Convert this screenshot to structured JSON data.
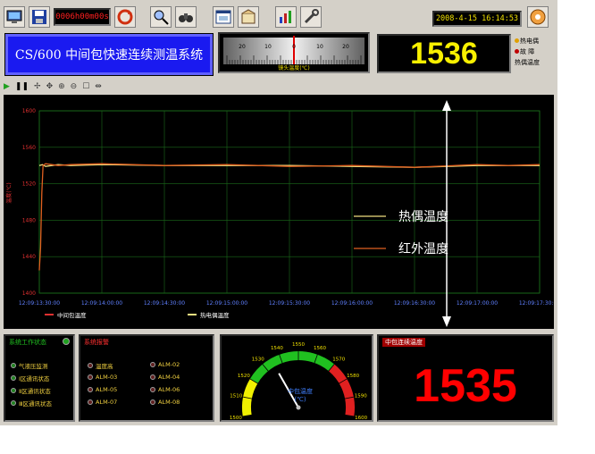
{
  "toolbar": {
    "timer_display": "0006h00m00s",
    "datetime": "2008-4-15 16:14:53",
    "icons": [
      "monitor-icon",
      "save-icon",
      "refresh-icon",
      "search-icon",
      "binoculars-icon",
      "window-icon",
      "cabinet-icon",
      "chart-icon",
      "tools-icon",
      "info-icon"
    ]
  },
  "header": {
    "system_title": "CS/600 中间包快速连续测温系统",
    "scale_label": "镜头温度(℃)",
    "scale_ticks": [
      "20",
      "10",
      "0",
      "10",
      "20"
    ],
    "current_temp": "1536",
    "legend": [
      {
        "label": "热电偶",
        "color": "#e0a000"
      },
      {
        "label": "故 障",
        "color": "#c00000"
      },
      {
        "label": "热偶温度",
        "color": ""
      }
    ]
  },
  "chart_tools": [
    "▶",
    "❚❚",
    "✢",
    "✥",
    "⊕",
    "⊖",
    "☐",
    "⇹"
  ],
  "chart_data": {
    "type": "line",
    "ylabel": "温度(℃)",
    "y_ticks": [
      "1600",
      "1560",
      "1520",
      "1480",
      "1440",
      "1400"
    ],
    "ylim": [
      1400,
      1600
    ],
    "x_ticks": [
      "12:09:13:30:00",
      "12:09:14:00:00",
      "12:09:14:30:00",
      "12:09:15:00:00",
      "12:09:15:30:00",
      "12:09:16:00:00",
      "12:09:16:30:00",
      "12:09:17:00:00",
      "12:09:17:30:00"
    ],
    "series": [
      {
        "name": "热电偶温度",
        "color": "#f0e080",
        "x": [
          0,
          0.05,
          0.1,
          0.2,
          0.3,
          0.5,
          1,
          2,
          3,
          4,
          5,
          6,
          7,
          7.5,
          8
        ],
        "values": [
          1540,
          1541,
          1539,
          1540,
          1541,
          1540,
          1541,
          1540,
          1540,
          1540,
          1539,
          1538,
          1540,
          1540,
          1540
        ]
      },
      {
        "name": "中间包温度",
        "color": "#e06020",
        "x": [
          0,
          0.02,
          0.04,
          0.06,
          0.1,
          0.2,
          0.3,
          0.5,
          1,
          2,
          3,
          4,
          5,
          6,
          7,
          7.5,
          8
        ],
        "values": [
          1425,
          1450,
          1510,
          1540,
          1542,
          1541,
          1540,
          1541,
          1542,
          1540,
          1541,
          1539,
          1540,
          1538,
          1541,
          1540,
          1541
        ]
      }
    ],
    "overlay_legend": [
      "热偶温度",
      "红外温度"
    ]
  },
  "panels": {
    "status": {
      "title": "系统工作状态",
      "items": [
        "气液压监测",
        "Ⅰ区通讯状态",
        "Ⅱ区通讯状态",
        "Ⅲ区通讯状态"
      ]
    },
    "alarm": {
      "title": "系统报警",
      "left": [
        "温度高",
        "ALM-03",
        "ALM-05",
        "ALM-07"
      ],
      "right": [
        "ALM-02",
        "ALM-04",
        "ALM-06",
        "ALM-08"
      ]
    },
    "gauge": {
      "label": "中包温度",
      "unit": "(℃)",
      "value": 1535,
      "min": 1500,
      "max": 1600,
      "ticks": [
        "1500",
        "1510",
        "1520",
        "1530",
        "1540",
        "1550",
        "1560",
        "1570",
        "1580",
        "1590",
        "1600"
      ]
    },
    "continuous": {
      "title": "中包连续温度",
      "value": "1535"
    }
  }
}
